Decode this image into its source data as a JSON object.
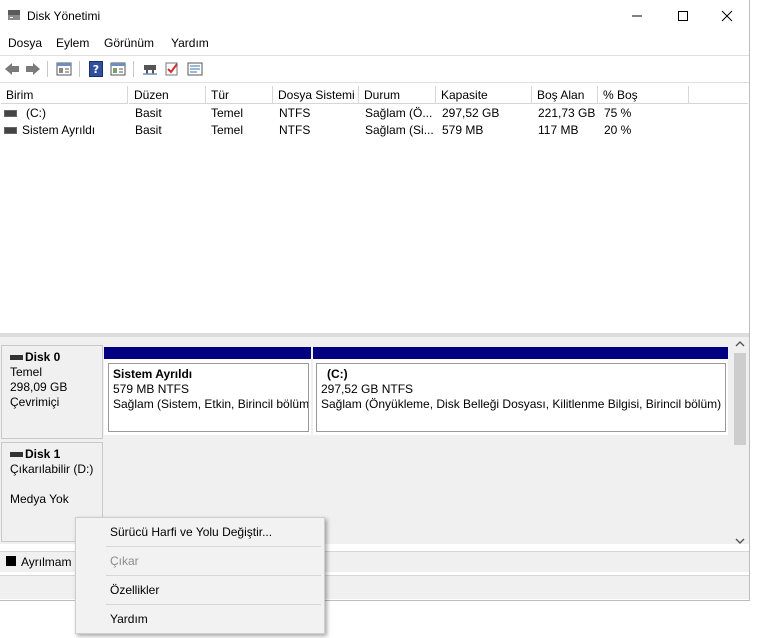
{
  "window": {
    "title": "Disk Yönetimi",
    "controls": {
      "minimize": "—",
      "maximize": "☐",
      "close": "✕"
    }
  },
  "menu": [
    "Dosya",
    "Eylem",
    "Görünüm",
    "Yardım"
  ],
  "toolbar": {
    "icons": [
      "back-arrow-icon",
      "forward-arrow-icon",
      "properties-icon",
      "help-icon",
      "console-icon",
      "connect-icon",
      "check-icon",
      "settings-icon"
    ]
  },
  "volume_list": {
    "columns": [
      "Birim",
      "Düzen",
      "Tür",
      "Dosya Sistemi",
      "Durum",
      "Kapasite",
      "Boş Alan",
      "% Boş"
    ],
    "rows": [
      {
        "birim": "(C:)",
        "duzen": "Basit",
        "tur": "Temel",
        "dosya_sistemi": "NTFS",
        "durum": "Sağlam (Ö...",
        "kapasite": "297,52 GB",
        "bos_alan": "221,73 GB",
        "yuzde_bos": "75 %"
      },
      {
        "birim": "Sistem Ayrıldı",
        "duzen": "Basit",
        "tur": "Temel",
        "dosya_sistemi": "NTFS",
        "durum": "Sağlam (Si...",
        "kapasite": "579 MB",
        "bos_alan": "117 MB",
        "yuzde_bos": "20 %"
      }
    ]
  },
  "disks": [
    {
      "name": "Disk 0",
      "type": "Temel",
      "size": "298,09 GB",
      "status": "Çevrimiçi",
      "partitions": [
        {
          "name": "Sistem Ayrıldı",
          "size_fs": "579 MB NTFS",
          "status": "Sağlam (Sistem, Etkin, Birincil bölüm"
        },
        {
          "name": "(C:)",
          "size_fs": "297,52 GB NTFS",
          "status": "Sağlam (Önyükleme, Disk Belleği Dosyası, Kilitlenme Bilgisi, Birincil bölüm)"
        }
      ]
    },
    {
      "name": "Disk 1",
      "type": "Çıkarılabilir (D:)",
      "media": "Medya Yok"
    }
  ],
  "legend": {
    "unallocated": "Ayrılmam"
  },
  "context_menu": {
    "items": [
      {
        "label": "Sürücü Harfi ve Yolu Değiştir...",
        "enabled": true
      },
      {
        "label": "Çıkar",
        "enabled": false
      },
      {
        "label": "Özellikler",
        "enabled": true
      },
      {
        "label": "Yardım",
        "enabled": true
      }
    ]
  },
  "colors": {
    "partition_bar": "#000080",
    "disabled_text": "#8c8c8c"
  }
}
